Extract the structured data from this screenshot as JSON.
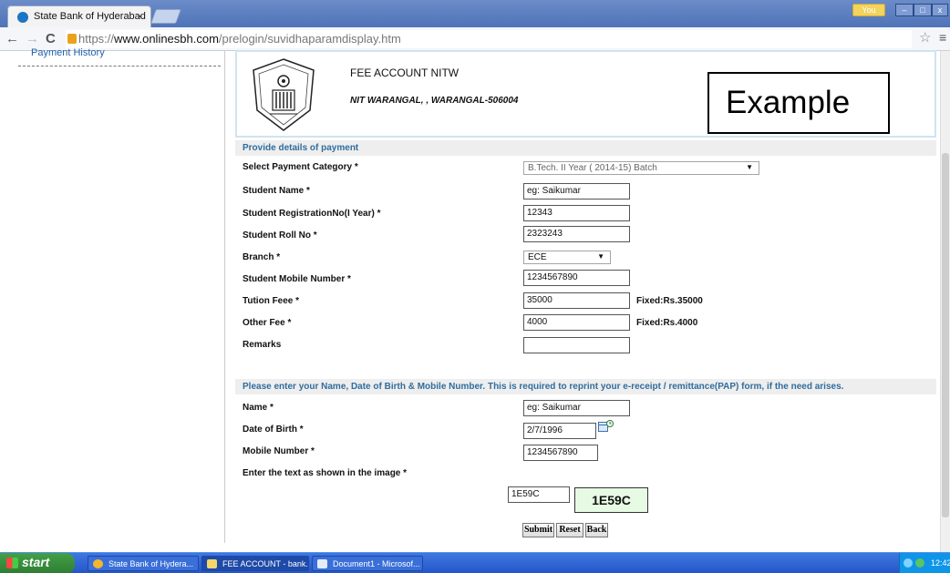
{
  "browser": {
    "tab_title": "State Bank of Hyderabad",
    "tab_close": "×",
    "profile_label": "You",
    "url_scheme": "https://",
    "url_host": "www.onlinesbh.com",
    "url_path": "/prelogin/suvidhaparamdisplay.htm"
  },
  "sidebar": {
    "payment_history": "Payment History"
  },
  "header": {
    "institute_name": "FEE ACCOUNT NITW",
    "institute_address": "NIT WARANGAL, , WARANGAL-506004",
    "example_label": "Example"
  },
  "payment_section": {
    "title": "Provide details of payment",
    "fields": {
      "category_label": "Select Payment Category *",
      "category_value": "B.Tech. II Year ( 2014-15) Batch",
      "student_name_label": "Student Name *",
      "student_name_value": "eg: Saikumar",
      "registration_label": "Student RegistrationNo(I Year) *",
      "registration_value": "12343",
      "roll_label": "Student Roll No *",
      "roll_value": "2323243",
      "branch_label": "Branch *",
      "branch_value": "ECE",
      "mobile_label": "Student Mobile Number *",
      "mobile_value": "1234567890",
      "tuition_label": "Tution Feee *",
      "tuition_value": "35000",
      "tuition_hint": "Fixed:Rs.35000",
      "other_fee_label": "Other Fee *",
      "other_fee_value": "4000",
      "other_fee_hint": "Fixed:Rs.4000",
      "remarks_label": "Remarks",
      "remarks_value": ""
    }
  },
  "reprint_section": {
    "title": "Please enter your Name, Date of Birth & Mobile Number. This is required to reprint your e-receipt / remittance(PAP) form, if the need arises.",
    "name_label": "Name *",
    "name_value": "eg: Saikumar",
    "dob_label": "Date of Birth *",
    "dob_value": "2/7/1996",
    "mobile_label": "Mobile Number *",
    "mobile_value": "1234567890",
    "captcha_label": "Enter the text as shown in the image *",
    "captcha_input": "1E59C",
    "captcha_image_text": "1E59C"
  },
  "buttons": {
    "submit": "Submit",
    "reset": "Reset",
    "back": "Back"
  },
  "taskbar": {
    "start": "start",
    "tasks": [
      "State Bank of Hydera...",
      "FEE ACCOUNT - bank...",
      "Document1 - Microsof..."
    ],
    "clock": "12:42"
  },
  "colors": {
    "section_title": "#2f6d9e",
    "taskbar": "#2456c8",
    "start_button": "#2e7d32",
    "captcha_bg": "#e7fbe4"
  },
  "icons": [
    "lock-icon",
    "star-icon",
    "menu-icon",
    "calendar-icon",
    "chevron-down-icon",
    "windows-flag-icon"
  ]
}
